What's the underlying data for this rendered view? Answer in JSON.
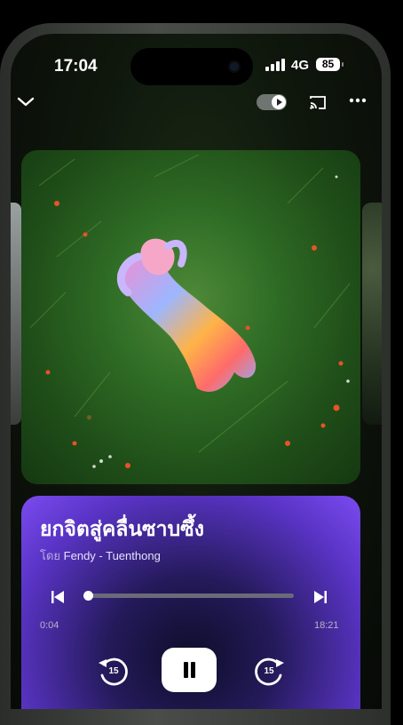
{
  "status_bar": {
    "time": "17:04",
    "network": "4G",
    "battery": "85"
  },
  "header": {
    "collapse_icon": "chevron-down-icon",
    "video_toggle_icon": "play-toggle-icon",
    "cast_icon": "cast-icon",
    "more_icon": "more-dots-icon"
  },
  "track": {
    "title": "ยกจิตสู่คลื่นซาบซึ้ง",
    "by_label": "โดย",
    "artist": "Fendy - Tuenthong"
  },
  "playback": {
    "elapsed": "0:04",
    "total": "18:21",
    "progress": 0.004,
    "skip_back_seconds": "15",
    "skip_forward_seconds": "15",
    "state": "playing"
  },
  "colors": {
    "player_accent": "#7b4bf0",
    "player_dark": "#0f0d2a"
  }
}
